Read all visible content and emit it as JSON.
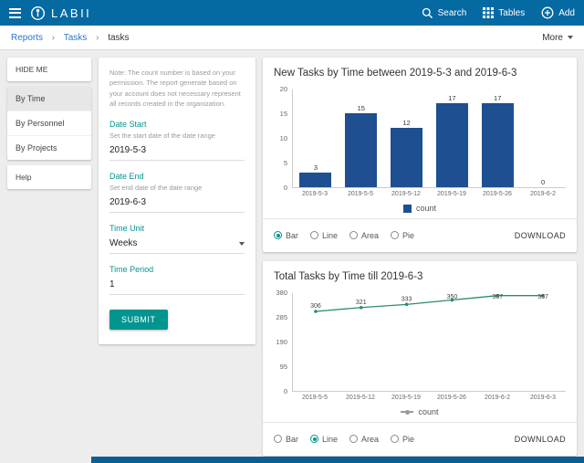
{
  "header": {
    "brand": "LABII",
    "actions": [
      {
        "label": "Search"
      },
      {
        "label": "Tables"
      },
      {
        "label": "Add"
      }
    ]
  },
  "breadcrumb": {
    "items": [
      "Reports",
      "Tasks",
      "tasks"
    ],
    "separator": "›",
    "more_label": "More"
  },
  "sidebar": {
    "hide_label": "HIDE ME",
    "items": [
      {
        "label": "By Time",
        "selected": true
      },
      {
        "label": "By Personnel",
        "selected": false
      },
      {
        "label": "By Projects",
        "selected": false
      }
    ],
    "help_label": "Help"
  },
  "form": {
    "note": "Note: The count number is based on your permission. The report generate based on your account does not necessary represent all records created in the organization.",
    "fields": [
      {
        "label": "Date Start",
        "help": "Set the start date of the date range",
        "value": "2019-5-3"
      },
      {
        "label": "Date End",
        "help": "Set end date of the date range",
        "value": "2019-6-3"
      },
      {
        "label": "Time Unit",
        "help": "",
        "value": "Weeks"
      },
      {
        "label": "Time Period",
        "help": "",
        "value": "1"
      }
    ],
    "submit_label": "SUBMIT"
  },
  "chart_data": [
    {
      "type": "bar",
      "title": "New Tasks by Time between 2019-5-3 and 2019-6-3",
      "categories": [
        "2019-5-3",
        "2019-5-5",
        "2019-5-12",
        "2019-5-19",
        "2019-5-26",
        "2019-6-2"
      ],
      "values": [
        3,
        15,
        12,
        17,
        17,
        0
      ],
      "ylim": [
        0,
        20
      ],
      "yticks": [
        0,
        5,
        10,
        15,
        20
      ],
      "legend": "count",
      "bar_color": "#1d4f91",
      "options": [
        "Bar",
        "Line",
        "Area",
        "Pie"
      ],
      "selected_option": "Bar",
      "download_label": "DOWNLOAD"
    },
    {
      "type": "line",
      "title": "Total Tasks by Time till 2019-6-3",
      "categories": [
        "2019-5-5",
        "2019-5-12",
        "2019-5-19",
        "2019-5-26",
        "2019-6-2",
        "2019-6-3"
      ],
      "values": [
        306,
        321,
        333,
        350,
        367,
        367
      ],
      "ylim": [
        0,
        380
      ],
      "yticks": [
        0,
        95,
        190,
        285,
        380
      ],
      "legend": "count",
      "line_color": "#2e8b74",
      "options": [
        "Bar",
        "Line",
        "Area",
        "Pie"
      ],
      "selected_option": "Line",
      "download_label": "DOWNLOAD"
    }
  ]
}
